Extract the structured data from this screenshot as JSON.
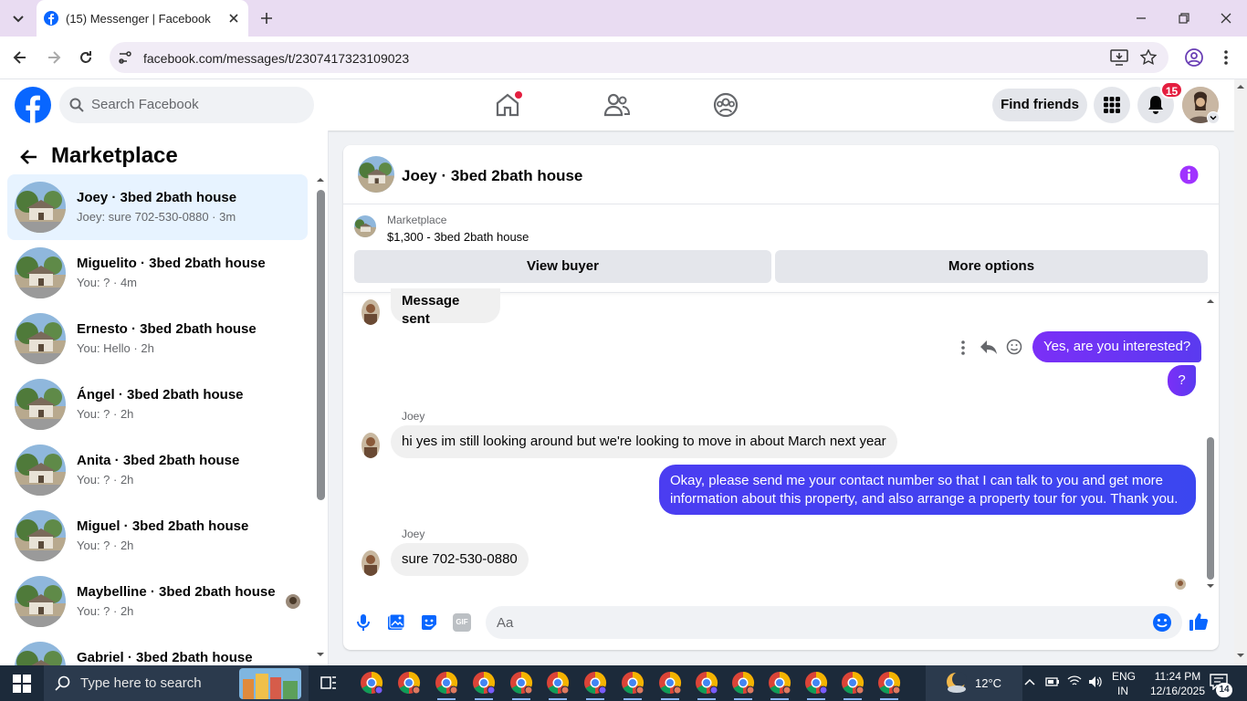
{
  "browser": {
    "tab_title": "(15) Messenger | Facebook",
    "url": "facebook.com/messages/t/2307417323109023"
  },
  "header": {
    "search_placeholder": "Search Facebook",
    "find_friends": "Find friends",
    "notif_count": "15"
  },
  "sidebar": {
    "title": "Marketplace",
    "conversations": [
      {
        "name": "Joey · 3bed 2bath house",
        "preview": "Joey: sure 702-530-0880 · 3m"
      },
      {
        "name": "Miguelito · 3bed 2bath house",
        "preview": "You: ? · 4m"
      },
      {
        "name": "Ernesto · 3bed 2bath house",
        "preview": "You: Hello · 2h"
      },
      {
        "name": "Ángel · 3bed 2bath house",
        "preview": "You: ? · 2h"
      },
      {
        "name": "Anita · 3bed 2bath house",
        "preview": "You: ? · 2h"
      },
      {
        "name": "Miguel · 3bed 2bath house",
        "preview": "You: ? · 2h"
      },
      {
        "name": "Maybelline · 3bed 2bath house",
        "preview": "You: ? · 2h"
      },
      {
        "name": "Gabriel · 3bed 2bath house",
        "preview": ""
      }
    ]
  },
  "chat": {
    "title": "Joey · 3bed 2bath house",
    "marketplace_label": "Marketplace",
    "item": "$1,300 - 3bed 2bath house",
    "view_buyer": "View buyer",
    "more_options": "More options",
    "messages": {
      "m1": "Message sent",
      "m2": "Yes, are you interested?",
      "m3": "?",
      "sender1": "Joey",
      "m4": "hi yes im still looking around but we're looking to move in about March next year",
      "m5a": "Okay, please send me your contact number so that I can talk to you and get more",
      "m5b": "information about this property, and also arrange a property tour for you. Thank you.",
      "sender2": "Joey",
      "m6": "sure 702-530-0880"
    },
    "composer_placeholder": "Aa",
    "gif_label": "GIF"
  },
  "taskbar": {
    "search": "Type here to search",
    "weather": "12°C",
    "lang1": "ENG",
    "lang2": "IN",
    "time": "11:24 PM",
    "date": "12/16/2025",
    "notif": "14"
  },
  "colors": {
    "fb_blue": "#0866ff",
    "accent_purple": "#a033ff"
  }
}
